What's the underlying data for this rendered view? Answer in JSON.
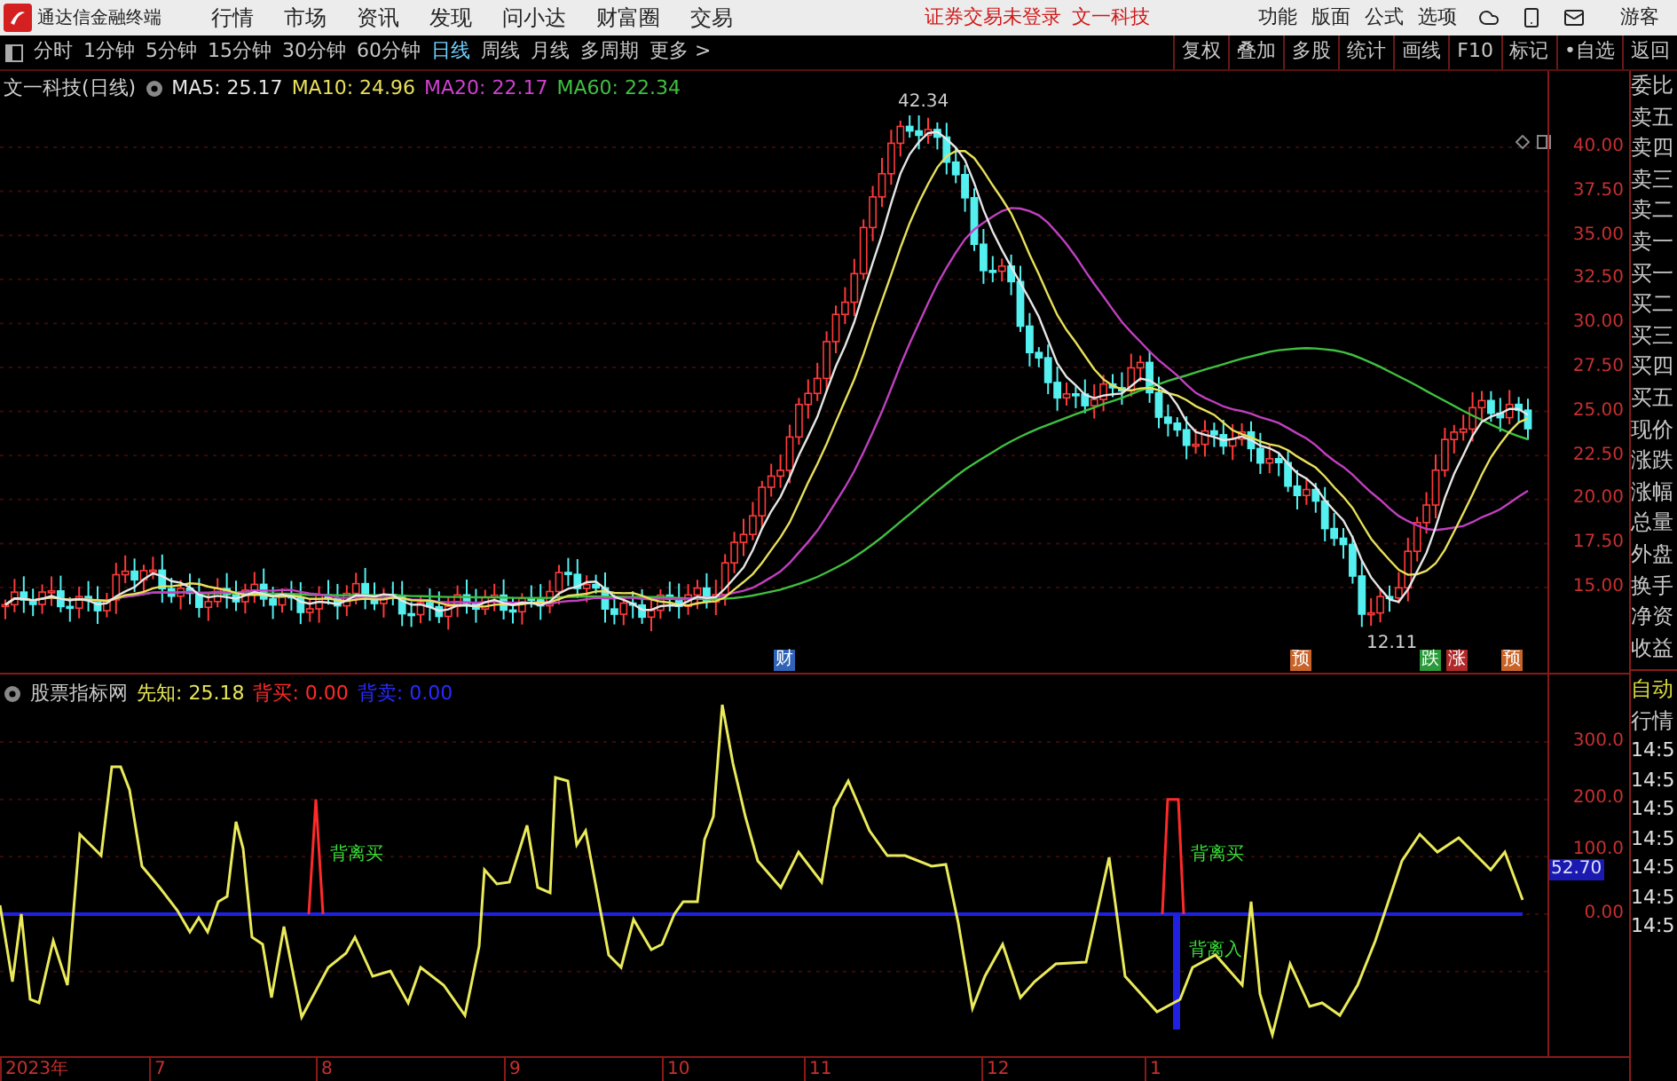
{
  "top_bar": {
    "app_title": "通达信金融终端",
    "menu": [
      "行情",
      "市场",
      "资讯",
      "发现",
      "问小达",
      "财富圈",
      "交易"
    ],
    "notice": "证券交易未登录",
    "stock": "文一科技",
    "tools": [
      "功能",
      "版面",
      "公式",
      "选项"
    ],
    "user": "游客"
  },
  "period_bar": {
    "periods": [
      {
        "label": "分时",
        "selected": false
      },
      {
        "label": "1分钟",
        "selected": false
      },
      {
        "label": "5分钟",
        "selected": false
      },
      {
        "label": "15分钟",
        "selected": false
      },
      {
        "label": "30分钟",
        "selected": false
      },
      {
        "label": "60分钟",
        "selected": false
      },
      {
        "label": "日线",
        "selected": true
      },
      {
        "label": "周线",
        "selected": false
      },
      {
        "label": "月线",
        "selected": false
      },
      {
        "label": "多周期",
        "selected": false
      },
      {
        "label": "更多 >",
        "selected": false
      }
    ],
    "actions": [
      "复权",
      "叠加",
      "多股",
      "统计",
      "画线",
      "F10",
      "标记",
      "•自选",
      "返回"
    ]
  },
  "price_chart": {
    "title": "文一科技(日线)",
    "moving_averages": [
      {
        "label": "MA5: 25.17",
        "color": "#e6e6e6"
      },
      {
        "label": "MA10: 24.96",
        "color": "#e8e05a"
      },
      {
        "label": "MA20: 22.17",
        "color": "#d040d0"
      },
      {
        "label": "MA60: 22.34",
        "color": "#40c040"
      }
    ],
    "high_label": "42.34",
    "low_label": "12.11",
    "event_markers": [
      {
        "text": "财",
        "color": "#2f63b8"
      },
      {
        "text": "预",
        "color": "#c8642a"
      },
      {
        "text": "跌",
        "color": "#2a9a3a"
      },
      {
        "text": "涨",
        "color": "#b02828"
      },
      {
        "text": "预",
        "color": "#c8642a"
      }
    ],
    "axis_ticks": [
      "40.00",
      "37.50",
      "35.00",
      "32.50",
      "30.00",
      "27.50",
      "25.00",
      "22.50",
      "20.00",
      "17.50",
      "15.00"
    ]
  },
  "quote_panel": {
    "labels": [
      "委比",
      "卖五",
      "卖四",
      "卖三",
      "卖二",
      "卖一",
      "买一",
      "买二",
      "买三",
      "买四",
      "买五",
      "现价",
      "涨跌",
      "涨幅",
      "总量",
      "外盘",
      "换手",
      "净资",
      "收益"
    ]
  },
  "indicator": {
    "title": "股票指标网",
    "series": [
      {
        "label": "先知: 25.18",
        "color": "#e8e85a"
      },
      {
        "label": "背买: 0.00",
        "color": "#ff2a2a"
      },
      {
        "label": "背卖: 0.00",
        "color": "#2a2aff"
      }
    ],
    "signals": [
      "背离买",
      "背离买",
      "背离入"
    ],
    "axis_ticks": [
      "300.0",
      "200.0",
      "100.0",
      "0.00"
    ],
    "current_value": "52.70"
  },
  "side_panel": {
    "mode": [
      "自动",
      "行情"
    ],
    "times": [
      "14:5",
      "14:5",
      "14:5",
      "14:5",
      "14:5",
      "14:5",
      "14:5"
    ]
  },
  "date_axis": [
    "2023年",
    "7",
    "8",
    "9",
    "10",
    "11",
    "12",
    "1"
  ]
}
